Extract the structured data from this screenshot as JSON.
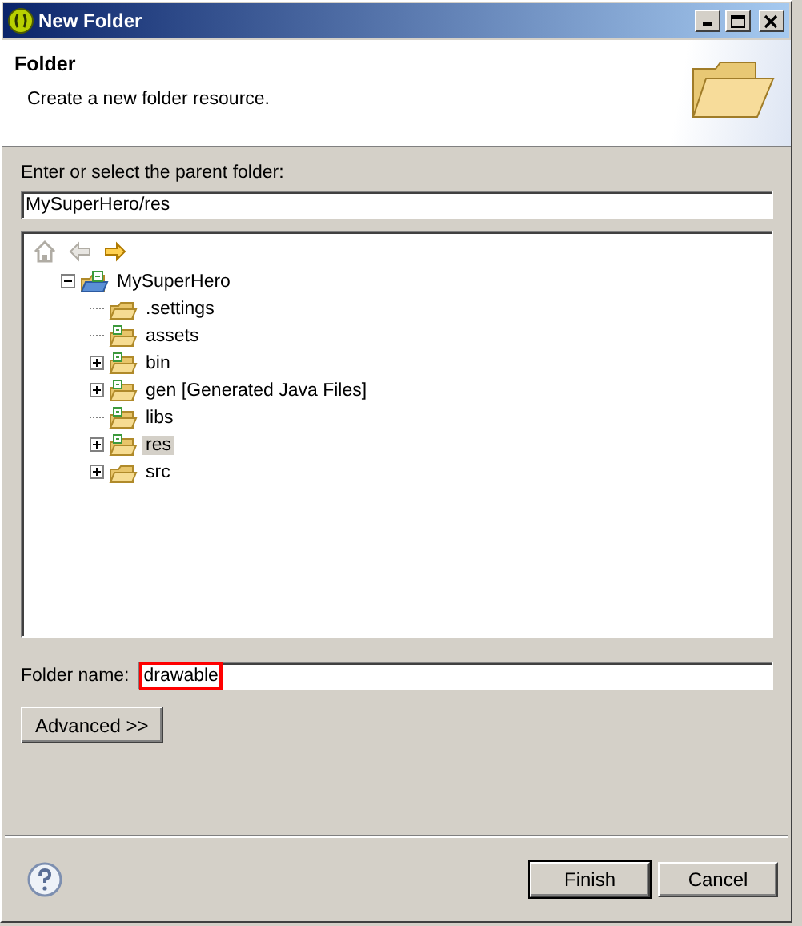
{
  "window": {
    "title": "New Folder"
  },
  "header": {
    "title": "Folder",
    "description": "Create a new folder resource."
  },
  "parent": {
    "label": "Enter or select the parent folder:",
    "value": "MySuperHero/res"
  },
  "nav": [
    {
      "kind": "home",
      "disabled": true
    },
    {
      "kind": "back",
      "disabled": true
    },
    {
      "kind": "forward",
      "disabled": false
    }
  ],
  "tree": {
    "label": "MySuperHero",
    "kind": "project",
    "expanded": true,
    "selected": false,
    "children": [
      {
        "label": ".settings",
        "kind": "folder",
        "selected": false
      },
      {
        "label": "assets",
        "kind": "source-folder",
        "selected": false
      },
      {
        "label": "bin",
        "kind": "source-folder",
        "expanded": false,
        "selected": false
      },
      {
        "label": "gen [Generated Java Files]",
        "kind": "source-folder",
        "expanded": false,
        "selected": false
      },
      {
        "label": "libs",
        "kind": "source-folder",
        "selected": false
      },
      {
        "label": "res",
        "kind": "source-folder",
        "expanded": false,
        "selected": true
      },
      {
        "label": "src",
        "kind": "folder",
        "expanded": false,
        "selected": false
      }
    ]
  },
  "folder_name": {
    "label": "Folder name:",
    "value": "drawable",
    "highlighted": true
  },
  "advanced_button": "Advanced >>",
  "buttons": [
    {
      "label": "Finish",
      "default": true
    },
    {
      "label": "Cancel",
      "default": false
    }
  ]
}
